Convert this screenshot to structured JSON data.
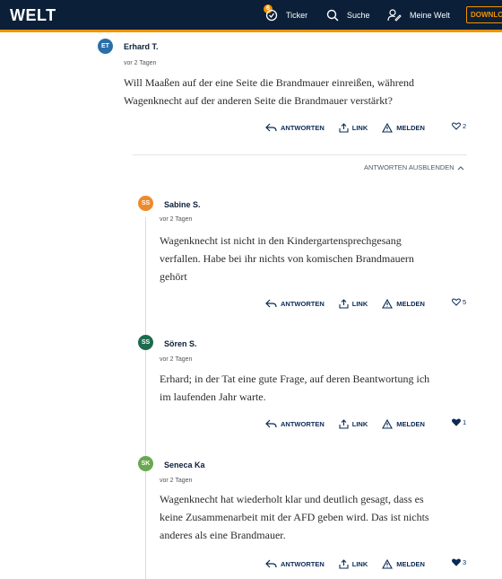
{
  "header": {
    "logo": "WELT",
    "ticker_badge": "6",
    "ticker_label": "Ticker",
    "suche_label": "Suche",
    "meine_welt_label": "Meine Welt",
    "download_label": "DOWNLOAD",
    "accent_color": "#f39200",
    "bg_color": "#0b1f38"
  },
  "actions": {
    "reply": "ANTWORTEN",
    "link": "LINK",
    "report": "MELDEN"
  },
  "hide_replies_label": "ANTWORTEN AUSBLENDEN",
  "comments": [
    {
      "initials": "ET",
      "name": "Erhard T.",
      "date": "vor 2 Tagen",
      "lines": [
        "Will Maaßen auf der eine Seite die Brandmauer einreißen, während",
        "Wagenknecht auf der anderen Seite die Brandmauer verstärkt?"
      ],
      "likes": "2",
      "liked": false,
      "avatar_color": "#2a6fa8"
    },
    {
      "initials": "SS",
      "name": "Sabine S.",
      "date": "vor 2 Tagen",
      "lines": [
        "Wagenknecht ist nicht in den Kindergartensprechgesang",
        "verfallen. Habe bei ihr nichts von komischen Brandmauern",
        "gehört"
      ],
      "likes": "5",
      "liked": false,
      "avatar_color": "#ee8a2b"
    },
    {
      "initials": "SS",
      "name": "Sören S.",
      "date": "vor 2 Tagen",
      "lines": [
        "Erhard; in der Tat eine gute Frage, auf deren Beantwortung ich",
        "im laufenden Jahr warte."
      ],
      "likes": "1",
      "liked": true,
      "avatar_color": "#1c6b4e"
    },
    {
      "initials": "SK",
      "name": "Seneca Ka",
      "date": "vor 2 Tagen",
      "lines": [
        "Wagenknecht hat wiederholt klar und deutlich gesagt, dass es",
        "keine Zusammenarbeit mit der AFD geben wird. Das ist nichts",
        "anderes als eine Brandmauer."
      ],
      "likes": "3",
      "liked": true,
      "avatar_color": "#6aa84f"
    }
  ]
}
